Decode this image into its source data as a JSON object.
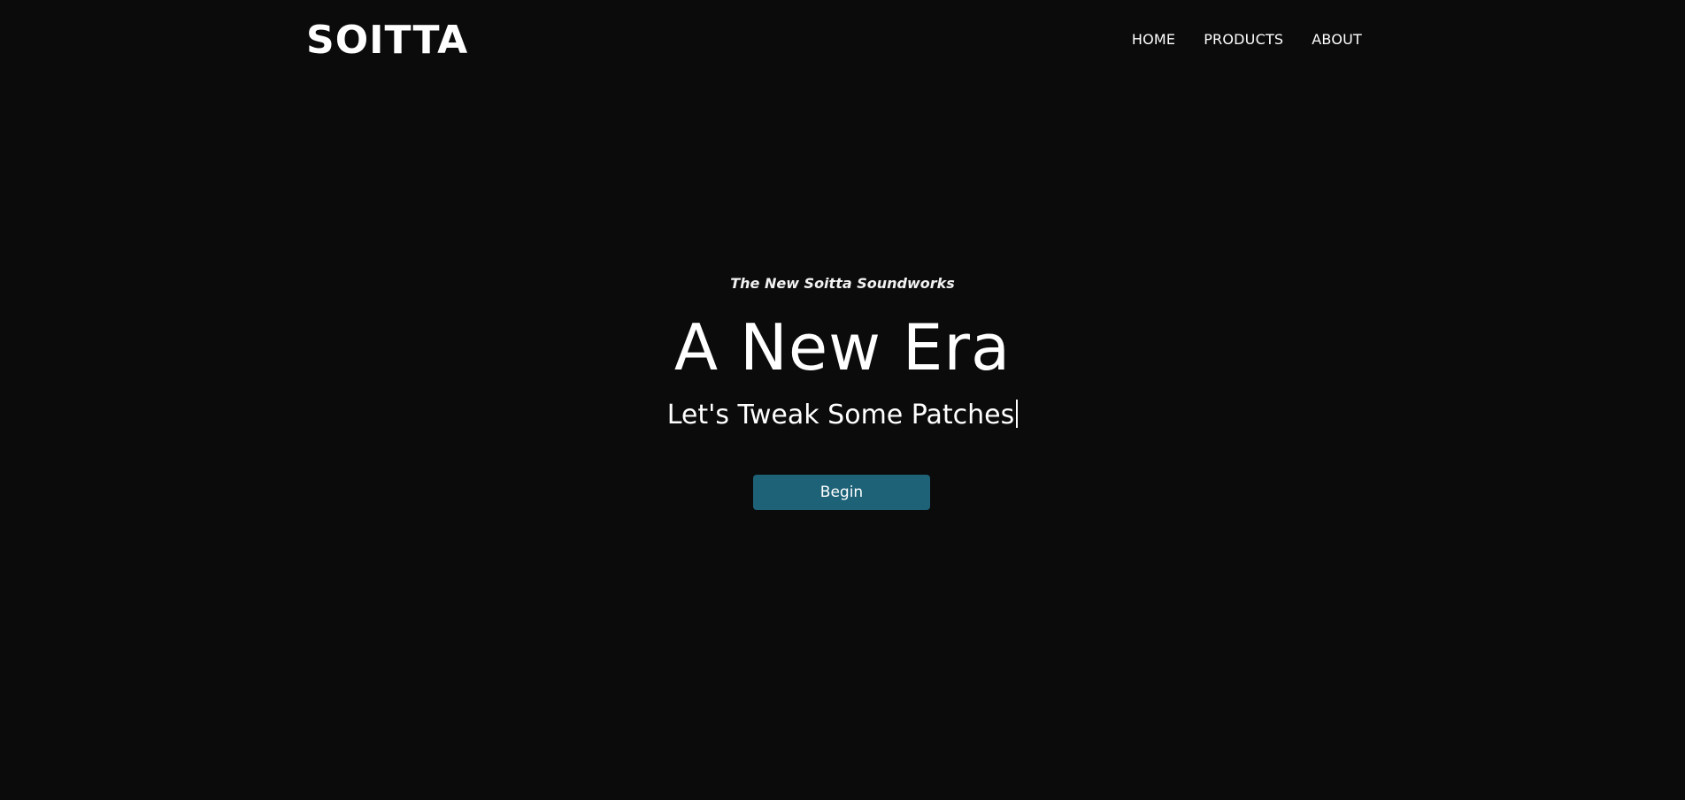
{
  "header": {
    "logo": "SOITTA",
    "nav": [
      {
        "label": "HOME"
      },
      {
        "label": "PRODUCTS"
      },
      {
        "label": "ABOUT"
      }
    ]
  },
  "hero": {
    "tagline": "The New Soitta Soundworks",
    "headline": "A New Era",
    "subline": "Let's Tweak Some Patches",
    "cta_label": "Begin"
  },
  "colors": {
    "background": "#0b0b0b",
    "text": "#ffffff",
    "button": "#1d6277"
  }
}
